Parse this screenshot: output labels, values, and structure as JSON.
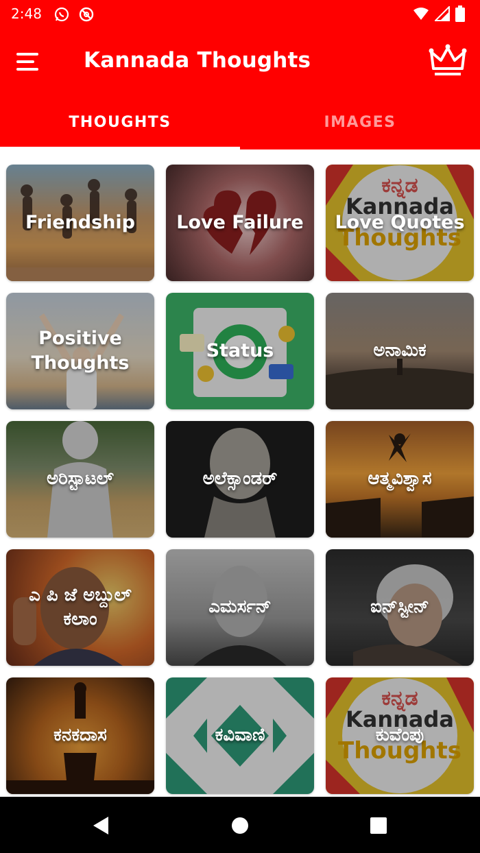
{
  "status_bar": {
    "time": "2:48",
    "left_icons": [
      "whatsapp-icon",
      "blocked-icon"
    ],
    "right_icons": [
      "wifi-icon",
      "signal-icon",
      "battery-icon"
    ]
  },
  "app_bar": {
    "title": "Kannada Thoughts",
    "menu_icon": "hamburger-menu-icon",
    "premium_icon": "crown-icon"
  },
  "tabs": [
    {
      "label": "THOUGHTS",
      "active": true
    },
    {
      "label": "IMAGES",
      "active": false
    }
  ],
  "categories": [
    {
      "label": "Friendship"
    },
    {
      "label": "Love Failure"
    },
    {
      "label": "Love Quotes"
    },
    {
      "label": "Positive Thoughts"
    },
    {
      "label": "Status"
    },
    {
      "label": "ಅನಾಮಿಕ"
    },
    {
      "label": "ಅರಿಸ್ಟಾಟಲ್"
    },
    {
      "label": "ಅಲೆಕ್ಸಾಂಡರ್"
    },
    {
      "label": "ಆತ್ಮವಿಶ್ವಾಸ"
    },
    {
      "label": "ಎ ಪಿ ಜೆ ಅಬ್ದುಲ್ ಕಲಾಂ"
    },
    {
      "label": "ಎಮರ್ಸನ್"
    },
    {
      "label": "ಐನ್‌ಸ್ಟೀನ್"
    },
    {
      "label": "ಕನಕದಾಸ"
    },
    {
      "label": "ಕವಿವಾಣಿ"
    },
    {
      "label": "ಕುವೆಂಪು"
    }
  ],
  "brand_image_text": {
    "kannada": "ಕನ್ನಡ",
    "line1": "Kannada",
    "line2": "Thoughts"
  },
  "nav_bar": {
    "back": "back-icon",
    "home": "home-icon",
    "recents": "recents-icon"
  },
  "colors": {
    "primary": "#ff0000",
    "tab_inactive": "rgba(255,255,255,0.6)",
    "nav_bar": "#000000"
  }
}
